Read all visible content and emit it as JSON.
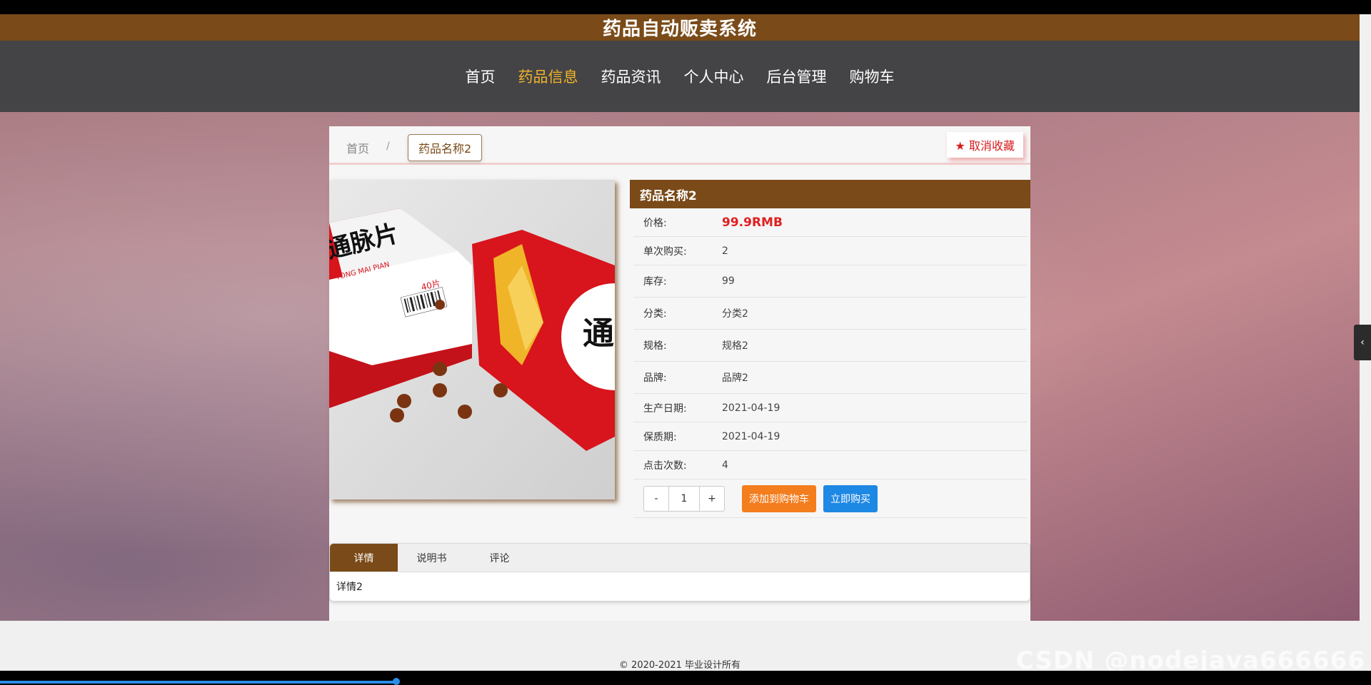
{
  "site": {
    "title": "药品自动贩卖系统"
  },
  "nav": {
    "items": [
      {
        "label": "首页"
      },
      {
        "label": "药品信息"
      },
      {
        "label": "药品资讯"
      },
      {
        "label": "个人中心"
      },
      {
        "label": "后台管理"
      },
      {
        "label": "购物车"
      }
    ],
    "active": "药品信息"
  },
  "breadcrumb": {
    "home": "首页",
    "separator": "/",
    "current": "药品名称2"
  },
  "favorite": {
    "label": "取消收藏"
  },
  "product": {
    "title": "药品名称2",
    "fields": [
      {
        "label": "价格:",
        "value": "99.9RMB"
      },
      {
        "label": "单次购买:",
        "value": "2"
      },
      {
        "label": "库存:",
        "value": "99"
      },
      {
        "label": "分类:",
        "value": "分类2"
      },
      {
        "label": "规格:",
        "value": "规格2"
      },
      {
        "label": "品牌:",
        "value": "品牌2"
      },
      {
        "label": "生产日期:",
        "value": "2021-04-19"
      },
      {
        "label": "保质期:",
        "value": "2021-04-19"
      },
      {
        "label": "点击次数:",
        "value": "4"
      }
    ],
    "image_text": {
      "box_name": "通脉片",
      "box_brand": "TONG MAI PIAN",
      "box_count": "40片",
      "box_name2": "通"
    }
  },
  "purchase": {
    "minus": "-",
    "quantity": "1",
    "plus": "+",
    "add_to_cart": "添加到购物车",
    "buy_now": "立即购买"
  },
  "tabs": {
    "items": [
      {
        "label": "详情"
      },
      {
        "label": "说明书"
      },
      {
        "label": "评论"
      }
    ],
    "active": "详情",
    "content": "详情2"
  },
  "footer": {
    "text": "© 2020-2021 毕业设计所有"
  },
  "watermark": "CSDN @nodejava666666",
  "colors": {
    "brown": "#7a4a18",
    "nav_bg": "#444346",
    "price_red": "#e02020",
    "cart_orange": "#f47d1e",
    "buy_blue": "#1e88e5"
  }
}
